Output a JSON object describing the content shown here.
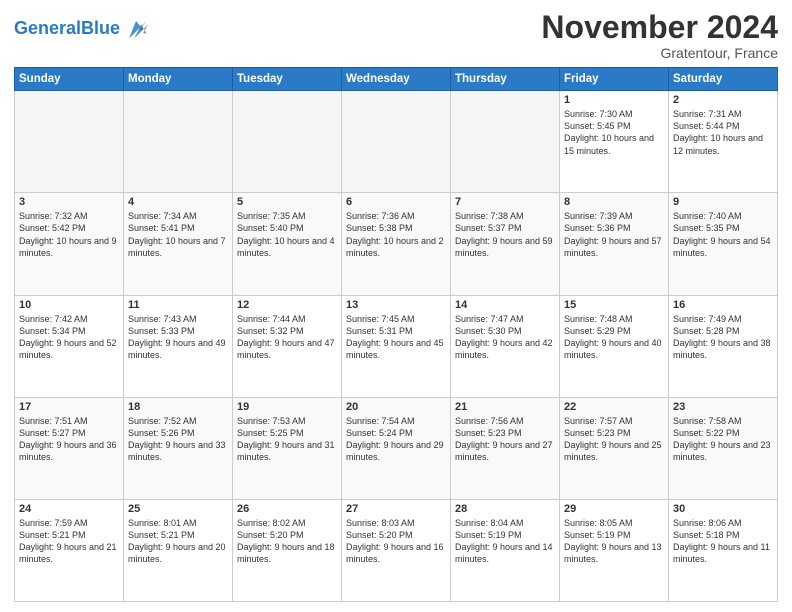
{
  "header": {
    "logo_general": "General",
    "logo_blue": "Blue",
    "month": "November 2024",
    "location": "Gratentour, France"
  },
  "days_of_week": [
    "Sunday",
    "Monday",
    "Tuesday",
    "Wednesday",
    "Thursday",
    "Friday",
    "Saturday"
  ],
  "weeks": [
    [
      {
        "day": "",
        "info": ""
      },
      {
        "day": "",
        "info": ""
      },
      {
        "day": "",
        "info": ""
      },
      {
        "day": "",
        "info": ""
      },
      {
        "day": "",
        "info": ""
      },
      {
        "day": "1",
        "info": "Sunrise: 7:30 AM\nSunset: 5:45 PM\nDaylight: 10 hours and 15 minutes."
      },
      {
        "day": "2",
        "info": "Sunrise: 7:31 AM\nSunset: 5:44 PM\nDaylight: 10 hours and 12 minutes."
      }
    ],
    [
      {
        "day": "3",
        "info": "Sunrise: 7:32 AM\nSunset: 5:42 PM\nDaylight: 10 hours and 9 minutes."
      },
      {
        "day": "4",
        "info": "Sunrise: 7:34 AM\nSunset: 5:41 PM\nDaylight: 10 hours and 7 minutes."
      },
      {
        "day": "5",
        "info": "Sunrise: 7:35 AM\nSunset: 5:40 PM\nDaylight: 10 hours and 4 minutes."
      },
      {
        "day": "6",
        "info": "Sunrise: 7:36 AM\nSunset: 5:38 PM\nDaylight: 10 hours and 2 minutes."
      },
      {
        "day": "7",
        "info": "Sunrise: 7:38 AM\nSunset: 5:37 PM\nDaylight: 9 hours and 59 minutes."
      },
      {
        "day": "8",
        "info": "Sunrise: 7:39 AM\nSunset: 5:36 PM\nDaylight: 9 hours and 57 minutes."
      },
      {
        "day": "9",
        "info": "Sunrise: 7:40 AM\nSunset: 5:35 PM\nDaylight: 9 hours and 54 minutes."
      }
    ],
    [
      {
        "day": "10",
        "info": "Sunrise: 7:42 AM\nSunset: 5:34 PM\nDaylight: 9 hours and 52 minutes."
      },
      {
        "day": "11",
        "info": "Sunrise: 7:43 AM\nSunset: 5:33 PM\nDaylight: 9 hours and 49 minutes."
      },
      {
        "day": "12",
        "info": "Sunrise: 7:44 AM\nSunset: 5:32 PM\nDaylight: 9 hours and 47 minutes."
      },
      {
        "day": "13",
        "info": "Sunrise: 7:45 AM\nSunset: 5:31 PM\nDaylight: 9 hours and 45 minutes."
      },
      {
        "day": "14",
        "info": "Sunrise: 7:47 AM\nSunset: 5:30 PM\nDaylight: 9 hours and 42 minutes."
      },
      {
        "day": "15",
        "info": "Sunrise: 7:48 AM\nSunset: 5:29 PM\nDaylight: 9 hours and 40 minutes."
      },
      {
        "day": "16",
        "info": "Sunrise: 7:49 AM\nSunset: 5:28 PM\nDaylight: 9 hours and 38 minutes."
      }
    ],
    [
      {
        "day": "17",
        "info": "Sunrise: 7:51 AM\nSunset: 5:27 PM\nDaylight: 9 hours and 36 minutes."
      },
      {
        "day": "18",
        "info": "Sunrise: 7:52 AM\nSunset: 5:26 PM\nDaylight: 9 hours and 33 minutes."
      },
      {
        "day": "19",
        "info": "Sunrise: 7:53 AM\nSunset: 5:25 PM\nDaylight: 9 hours and 31 minutes."
      },
      {
        "day": "20",
        "info": "Sunrise: 7:54 AM\nSunset: 5:24 PM\nDaylight: 9 hours and 29 minutes."
      },
      {
        "day": "21",
        "info": "Sunrise: 7:56 AM\nSunset: 5:23 PM\nDaylight: 9 hours and 27 minutes."
      },
      {
        "day": "22",
        "info": "Sunrise: 7:57 AM\nSunset: 5:23 PM\nDaylight: 9 hours and 25 minutes."
      },
      {
        "day": "23",
        "info": "Sunrise: 7:58 AM\nSunset: 5:22 PM\nDaylight: 9 hours and 23 minutes."
      }
    ],
    [
      {
        "day": "24",
        "info": "Sunrise: 7:59 AM\nSunset: 5:21 PM\nDaylight: 9 hours and 21 minutes."
      },
      {
        "day": "25",
        "info": "Sunrise: 8:01 AM\nSunset: 5:21 PM\nDaylight: 9 hours and 20 minutes."
      },
      {
        "day": "26",
        "info": "Sunrise: 8:02 AM\nSunset: 5:20 PM\nDaylight: 9 hours and 18 minutes."
      },
      {
        "day": "27",
        "info": "Sunrise: 8:03 AM\nSunset: 5:20 PM\nDaylight: 9 hours and 16 minutes."
      },
      {
        "day": "28",
        "info": "Sunrise: 8:04 AM\nSunset: 5:19 PM\nDaylight: 9 hours and 14 minutes."
      },
      {
        "day": "29",
        "info": "Sunrise: 8:05 AM\nSunset: 5:19 PM\nDaylight: 9 hours and 13 minutes."
      },
      {
        "day": "30",
        "info": "Sunrise: 8:06 AM\nSunset: 5:18 PM\nDaylight: 9 hours and 11 minutes."
      }
    ]
  ]
}
